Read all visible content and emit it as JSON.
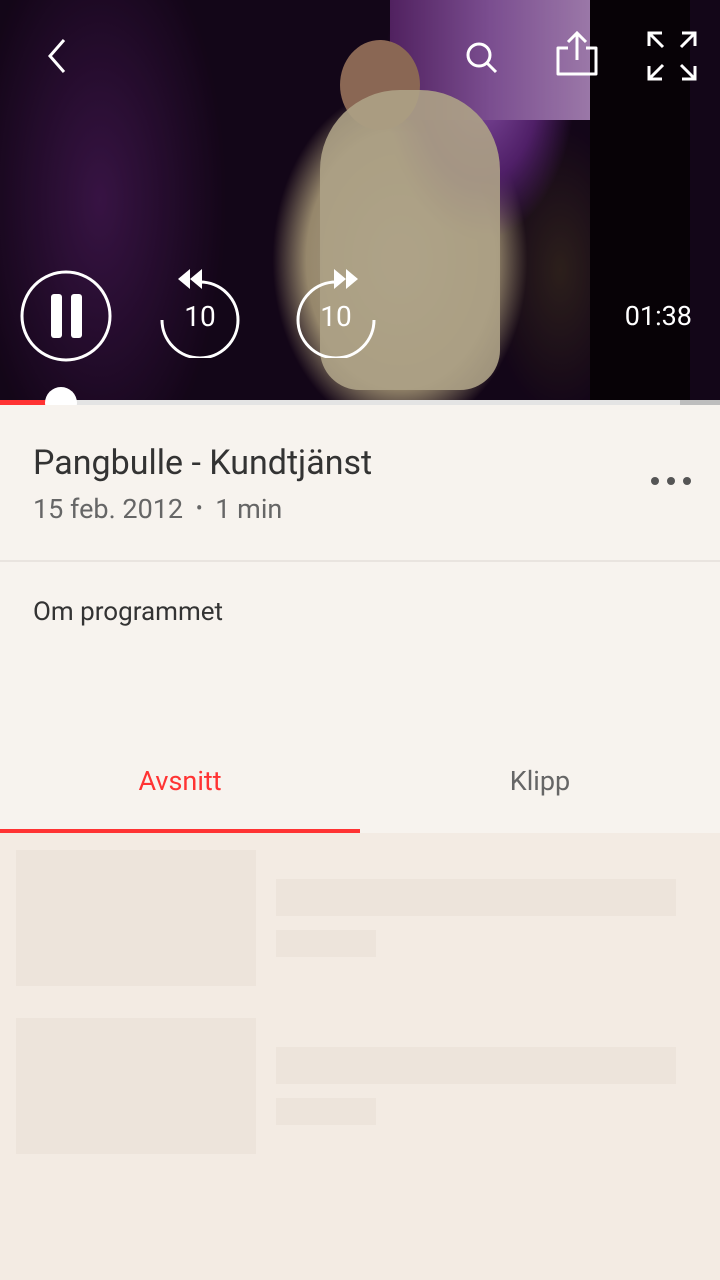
{
  "player": {
    "current_time": "01:38",
    "progress_fraction": 0.065,
    "buffered_fraction": 0.945,
    "skip_back_seconds": "10",
    "skip_forward_seconds": "10",
    "accent_color": "#ff3333"
  },
  "program": {
    "title": "Pangbulle - Kundtjänst",
    "date": "15 feb. 2012",
    "separator": "•",
    "duration": "1 min",
    "about_label": "Om programmet"
  },
  "tabs": [
    {
      "label": "Avsnitt",
      "active": true
    },
    {
      "label": "Klipp",
      "active": false
    }
  ]
}
